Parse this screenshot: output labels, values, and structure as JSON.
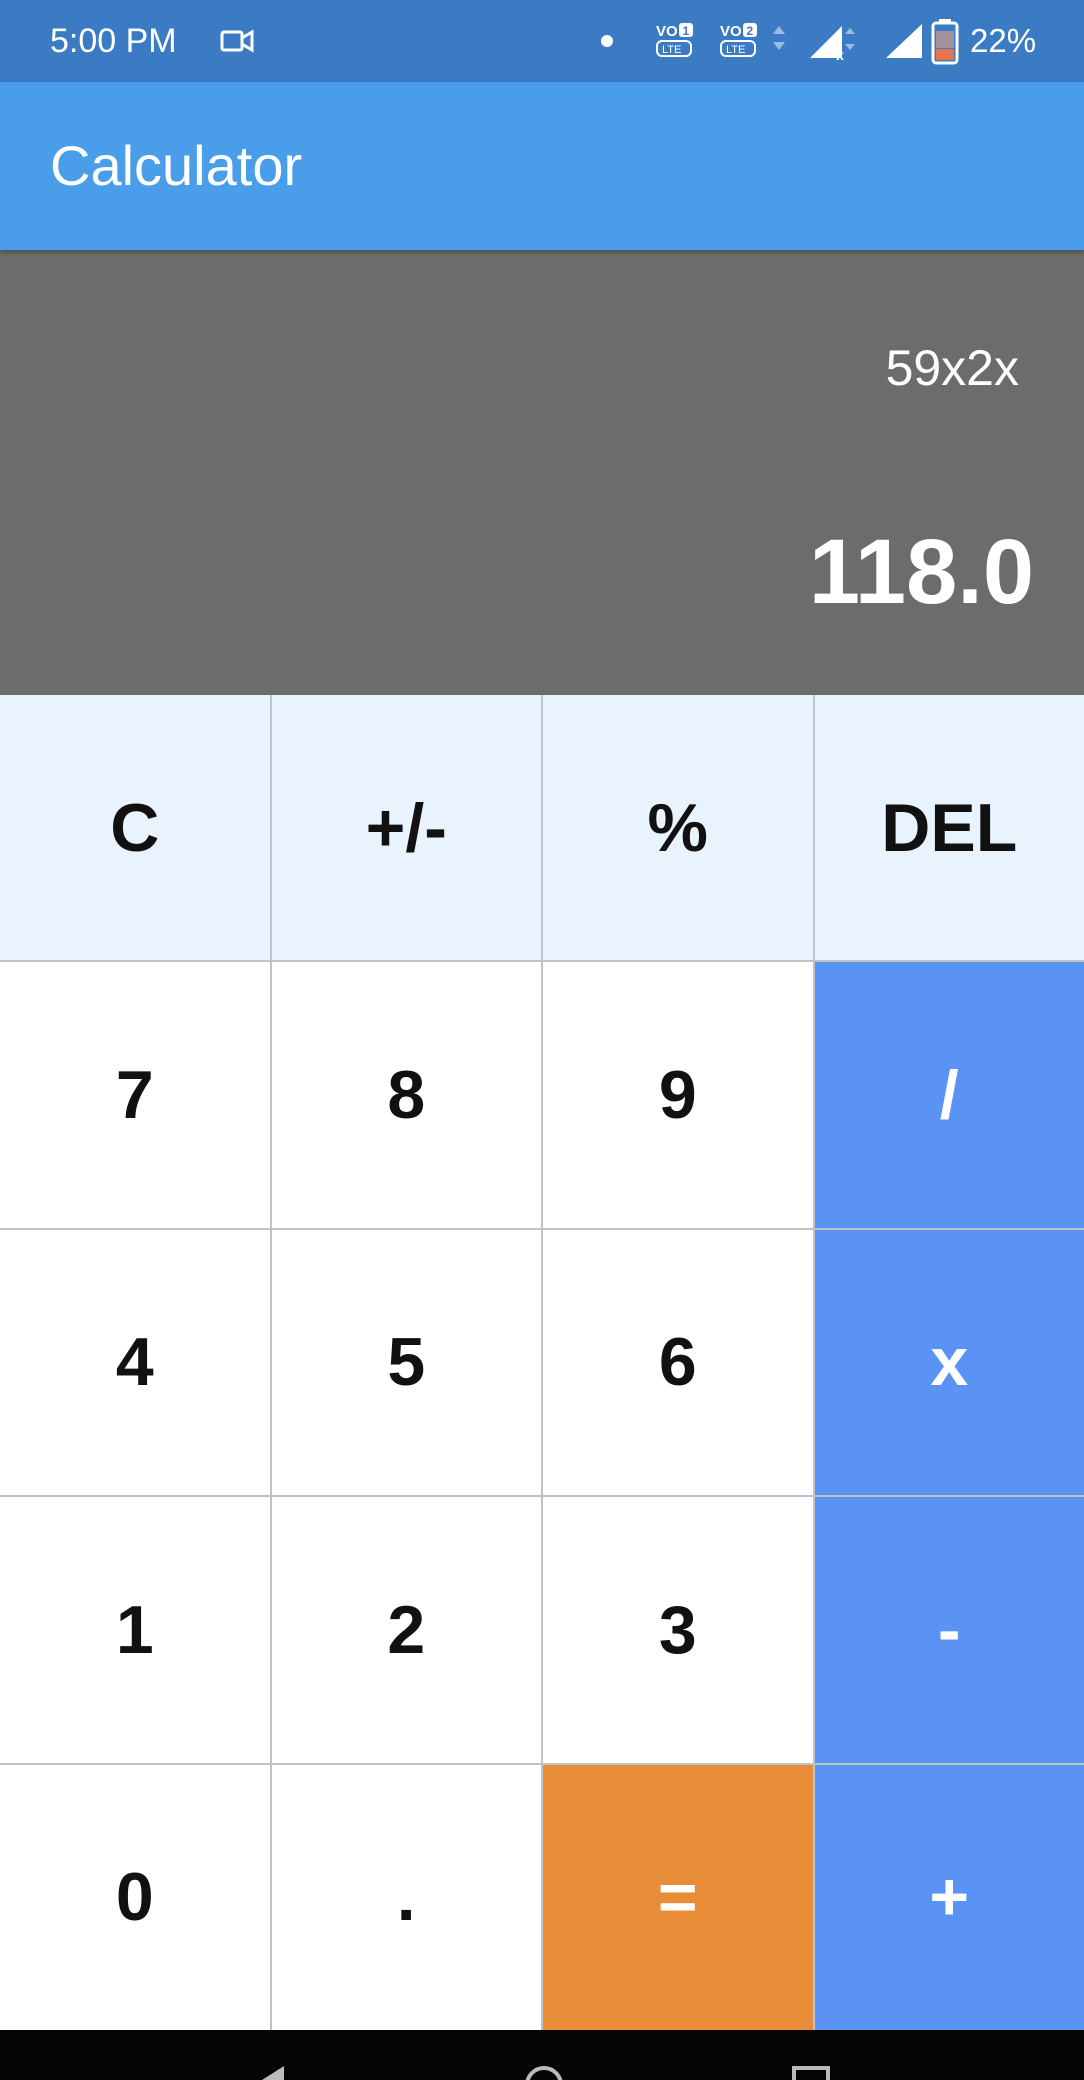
{
  "status_bar": {
    "time": "5:00 PM",
    "battery": "22%",
    "volte1": "VO 1 LTE",
    "volte2": "VO 2 LTE",
    "icons": [
      "video-camera-icon",
      "notification-dot-icon",
      "volte-1-icon",
      "volte-2-icon",
      "signal-1-icon",
      "signal-2-icon",
      "battery-icon"
    ]
  },
  "app_bar": {
    "title": "Calculator"
  },
  "display": {
    "expression": "59x2x",
    "result": "118.0"
  },
  "keypad": {
    "keys": [
      {
        "label": "C",
        "kind": "func",
        "name": "clear-button"
      },
      {
        "label": "+/-",
        "kind": "func",
        "name": "toggle-sign-button"
      },
      {
        "label": "%",
        "kind": "func",
        "name": "percent-button"
      },
      {
        "label": "DEL",
        "kind": "func",
        "name": "delete-button"
      },
      {
        "label": "7",
        "kind": "num",
        "name": "digit-7-button"
      },
      {
        "label": "8",
        "kind": "num",
        "name": "digit-8-button"
      },
      {
        "label": "9",
        "kind": "num",
        "name": "digit-9-button"
      },
      {
        "label": "/",
        "kind": "op",
        "name": "divide-button"
      },
      {
        "label": "4",
        "kind": "num",
        "name": "digit-4-button"
      },
      {
        "label": "5",
        "kind": "num",
        "name": "digit-5-button"
      },
      {
        "label": "6",
        "kind": "num",
        "name": "digit-6-button"
      },
      {
        "label": "x",
        "kind": "op",
        "name": "multiply-button"
      },
      {
        "label": "1",
        "kind": "num",
        "name": "digit-1-button"
      },
      {
        "label": "2",
        "kind": "num",
        "name": "digit-2-button"
      },
      {
        "label": "3",
        "kind": "num",
        "name": "digit-3-button"
      },
      {
        "label": "-",
        "kind": "op",
        "name": "subtract-button"
      },
      {
        "label": "0",
        "kind": "num",
        "name": "digit-0-button"
      },
      {
        "label": ".",
        "kind": "num",
        "name": "decimal-point-button"
      },
      {
        "label": "=",
        "kind": "eq",
        "name": "equals-button"
      },
      {
        "label": "+",
        "kind": "op",
        "name": "add-button"
      }
    ]
  },
  "colors": {
    "status_bar": "#3a7bc4",
    "app_bar": "#4a9de9",
    "display": "#6b6d6b",
    "func_key": "#e8f3fd",
    "op_key": "#5b93f5",
    "equals_key": "#e98c38"
  }
}
